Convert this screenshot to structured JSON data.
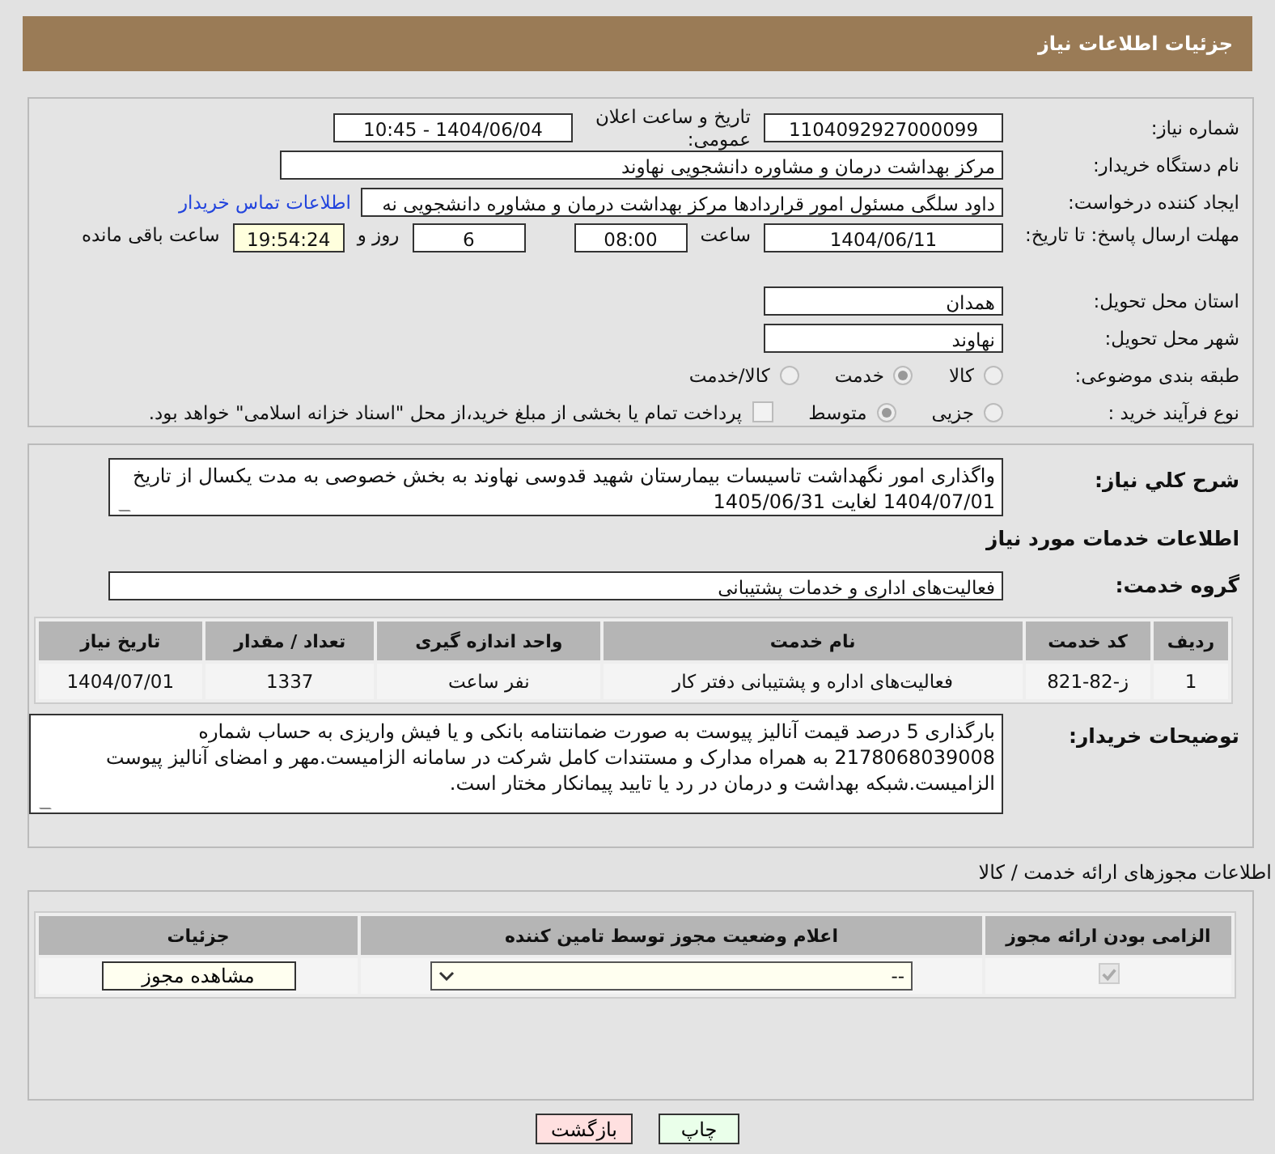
{
  "header": {
    "title": "جزئیات اطلاعات نیاز"
  },
  "need_info": {
    "need_number": {
      "label": "شماره نیاز:",
      "value": "1104092927000099"
    },
    "announce_date": {
      "label": "تاریخ و ساعت اعلان عمومی:",
      "value": "1404/06/04 - 10:45"
    },
    "buyer_org": {
      "label": "نام دستگاه خریدار:",
      "value": "مرکز بهداشت  درمان و مشاوره دانشجویی نهاوند"
    },
    "requester": {
      "label": "ایجاد کننده درخواست:",
      "value": "داود سلگی مسئول امور قراردادها مرکز بهداشت  درمان و مشاوره دانشجویی نه",
      "link": "اطلاعات تماس خریدار"
    },
    "deadline": {
      "label": "مهلت ارسال پاسخ: تا تاریخ:",
      "date": "1404/06/11",
      "time_label": "ساعت",
      "time": "08:00",
      "days": "6",
      "days_label": "روز و",
      "remaining": "19:54:24",
      "remaining_label": "ساعت باقی مانده"
    },
    "province": {
      "label": "استان محل تحویل:",
      "value": "همدان"
    },
    "city": {
      "label": "شهر محل تحویل:",
      "value": "نهاوند"
    },
    "category": {
      "label": "طبقه بندی موضوعی:",
      "options": [
        {
          "label": "کالا",
          "selected": false
        },
        {
          "label": "خدمت",
          "selected": true
        },
        {
          "label": "کالا/خدمت",
          "selected": false
        }
      ]
    },
    "process": {
      "label": "نوع فرآیند خرید :",
      "options": [
        {
          "label": "جزیی",
          "selected": false
        },
        {
          "label": "متوسط",
          "selected": true
        }
      ],
      "payment": {
        "checked": false,
        "text": "پرداخت تمام یا بخشی از مبلغ خرید،از محل \"اسناد خزانه اسلامی\" خواهد بود."
      }
    }
  },
  "services": {
    "description": {
      "label": "شرح کلي نياز:",
      "value": "واگذاری امور نگهداشت تاسیسات بیمارستان شهید قدوسی نهاوند به بخش خصوصی به مدت یکسال از تاریخ 1404/07/01 لغایت 1405/06/31"
    },
    "heading": "اطلاعات خدمات مورد نیاز",
    "group": {
      "label": "گروه خدمت:",
      "value": "فعالیت‌های اداری و خدمات پشتیبانی"
    },
    "table": {
      "columns": [
        "ردیف",
        "کد خدمت",
        "نام خدمت",
        "واحد اندازه گیری",
        "تعداد / مقدار",
        "تاریخ نیاز"
      ],
      "rows": [
        [
          "1",
          "ز-82-821",
          "فعالیت‌های اداره و پشتیبانی دفتر کار",
          "نفر ساعت",
          "1337",
          "1404/07/01"
        ]
      ]
    },
    "notes": {
      "label": "توضیحات خریدار:",
      "value": "بارگذاری 5 درصد قیمت آنالیز پیوست به صورت ضمانتنامه بانکی و یا فیش واریزی به حساب شماره 2178068039008 به همراه مدارک و مستندات کامل شرکت در سامانه الزامیست.مهر و امضای آنالیز پیوست الزامیست.شبکه بهداشت و درمان در رد یا تایید پیمانکار مختار است."
    }
  },
  "permits": {
    "title": "اطلاعات مجوزهای ارائه خدمت / کالا",
    "columns": [
      "الزامی بودن ارائه مجوز",
      "اعلام وضعیت مجوز توسط تامین کننده",
      "جزئیات"
    ],
    "rows": [
      {
        "required": true,
        "status": "--",
        "button": "مشاهده مجوز"
      }
    ]
  },
  "buttons": [
    {
      "label": "چاپ",
      "kind": "print"
    },
    {
      "label": "بازگشت",
      "kind": "back"
    }
  ]
}
